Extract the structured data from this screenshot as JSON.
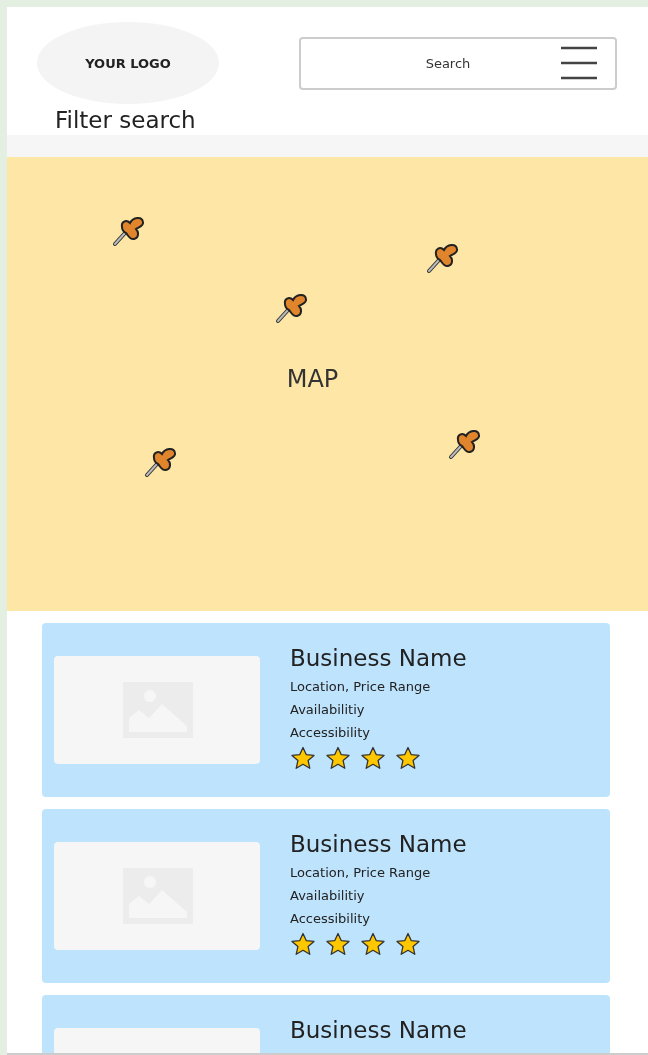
{
  "header": {
    "logo": "YOUR LOGO",
    "search": {
      "placeholder": "Search"
    }
  },
  "filter_label": "Filter search",
  "map": {
    "label": "MAP"
  },
  "listings": [
    {
      "name": "Business Name",
      "lines": [
        "Location, Price Range",
        "Availabilitiy",
        "Accessibility"
      ],
      "stars": 4
    },
    {
      "name": "Business Name",
      "lines": [
        "Location, Price Range",
        "Availabilitiy",
        "Accessibility"
      ],
      "stars": 4
    },
    {
      "name": "Business Name"
    }
  ]
}
